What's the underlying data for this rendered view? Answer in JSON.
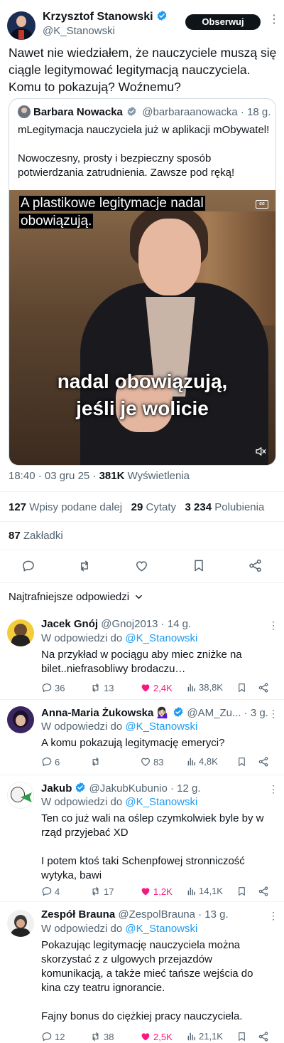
{
  "tweet": {
    "author_name": "Krzysztof Stanowski",
    "author_handle": "@K_Stanowski",
    "follow_label": "Obserwuj",
    "text": "Nawet nie wiedziałem, że nauczyciele muszą się ciągle legitymować legitymacją nauczyciela. Komu to pokazują? Woźnemu?",
    "time": "18:40 · 03 gru 25 ·",
    "views": "381K",
    "views_label": "Wyświetlenia",
    "reposts": "127",
    "reposts_label": "Wpisy podane dalej",
    "quotes": "29",
    "quotes_label": "Cytaty",
    "likes": "3 234",
    "likes_label": "Polubienia",
    "bookmarks": "87",
    "bookmarks_label": "Zakładki"
  },
  "quote": {
    "author_name": "Barbara Nowacka",
    "author_handle": "@barbaraanowacka · 18 g.",
    "text_line1": "mLegitymacja nauczyciela już w aplikacji mObywatel!",
    "text_line2": "Nowoczesny, prosty i bezpieczny sposób potwierdzania zatrudnienia. Zawsze pod ręką!",
    "caption_top": "A plastikowe legitymacje nadal obowiązują.",
    "caption_bottom_1": "nadal obowiązują,",
    "caption_bottom_2": "jeśli je wolicie",
    "cc_label": "cc"
  },
  "replies_header": "Najtrafniejsze odpowiedzi",
  "replies": [
    {
      "name": "Jacek Gnój",
      "handle": "@Gnoj2013 · 14 g.",
      "reply_prefix": "W odpowiedzi do",
      "mention": "@K_Stanowski",
      "text": "Na przykład w pociągu aby miec zniżke na bilet..niefrasobliwy brodaczu…",
      "replies": "36",
      "reposts": "13",
      "likes": "2,4K",
      "views": "38,8K"
    },
    {
      "name": "Anna-Maria Żukowska",
      "emoji": "💁🏻‍♀️",
      "handle": "@AM_Zu... · 3 g.",
      "reply_prefix": "W odpowiedzi do",
      "mention": "@K_Stanowski",
      "text": "A komu pokazują legitymację emeryci?",
      "replies": "6",
      "reposts": "",
      "likes": "83",
      "views": "4,8K"
    },
    {
      "name": "Jakub",
      "handle": "@JakubKubunio · 12 g.",
      "reply_prefix": "W odpowiedzi do",
      "mention": "@K_Stanowski",
      "text_p1": "Ten co już wali na oślep czymkolwiek byle by w rząd przyjebać XD",
      "text_p2": "I potem ktoś taki Schenpfowej stronniczość wytyka, bawi",
      "replies": "4",
      "reposts": "17",
      "likes": "1,2K",
      "views": "14,1K"
    },
    {
      "name": "Zespół Brauna",
      "handle": "@ZespolBrauna · 13 g.",
      "reply_prefix": "W odpowiedzi do",
      "mention": "@K_Stanowski",
      "text_p1": "Pokazując legitymację nauczyciela można skorzystać z z ulgowych przejazdów komunikacją, a także mieć tańsze wejścia do kina czy teatru ignorancie.",
      "text_p2": "Fajny bonus do ciężkiej pracy nauczyciela.",
      "replies": "12",
      "reposts": "38",
      "likes": "2,5K",
      "views": "21,1K"
    }
  ],
  "colors": {
    "text": "#0f1419",
    "secondary": "#536471",
    "link": "#1d9bf0",
    "like": "#f91880",
    "border": "#eff3f4"
  }
}
